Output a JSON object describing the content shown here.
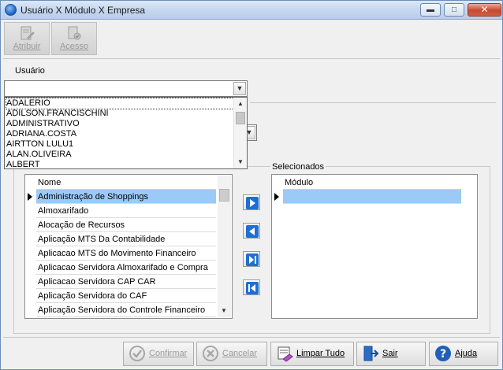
{
  "window": {
    "title": "Usuário X Módulo X Empresa",
    "minimize_glyph": "▬",
    "maximize_glyph": "□",
    "close_glyph": "✕"
  },
  "toolbar": {
    "atribuir_label": "Atribuir",
    "acesso_label": "Acesso"
  },
  "usuario": {
    "label": "Usuário",
    "value": "",
    "options": [
      "ADALERIO",
      "ADILSON.FRANCISCHINI",
      "ADMINISTRATIVO",
      "ADRIANA.COSTA",
      "AIRTTON LULU1",
      "ALAN.OLIVEIRA",
      "ALBERT"
    ]
  },
  "available": {
    "header": "Nome",
    "rows": [
      "Administração de Shoppings",
      "Almoxarifado",
      "Alocação de Recursos",
      "Aplicação MTS Da Contabilidade",
      "Aplicacao MTS do Movimento Financeiro",
      "Aplicacao Servidora Almoxarifado e Compra",
      "Aplicacao Servidora CAP CAR",
      "Aplicação Servidora do CAF",
      "Aplicação Servidora do Controle Financeiro"
    ]
  },
  "selected": {
    "label": "Selecionados",
    "header": "Módulo"
  },
  "buttons": {
    "confirmar": "Confirmar",
    "cancelar": "Cancelar",
    "limpar": "Limpar Tudo",
    "sair": "Sair",
    "ajuda": "Ajuda"
  },
  "colors": {
    "selection": "#9ccaf7",
    "arrow_blue": "#1e6fd0"
  }
}
